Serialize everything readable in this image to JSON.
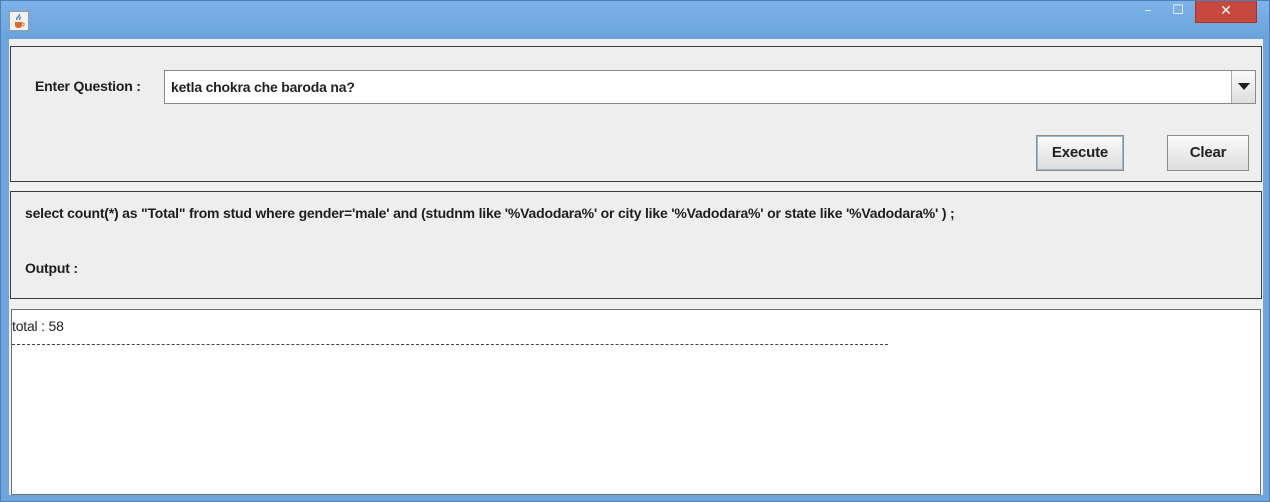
{
  "window": {
    "app_icon": "java-cup-icon",
    "controls": {
      "minimize_glyph": "–",
      "maximize_glyph": "☐",
      "close_glyph": "✕"
    }
  },
  "question": {
    "label": "Enter Question :",
    "value": "ketla chokra che baroda na?"
  },
  "actions": {
    "execute_label": "Execute",
    "clear_label": "Clear"
  },
  "query": {
    "sql": "select count(*) as \"Total\" from stud where gender='male' and (studnm like '%Vadodara%' or city like '%Vadodara%' or state like '%Vadodara%' ) ;",
    "output_label": "Output :"
  },
  "result": {
    "text": "total : 58"
  },
  "colors": {
    "titlebar": "#6ea5dd",
    "close_button": "#c7483f",
    "panel_bg": "#eeeeee"
  }
}
